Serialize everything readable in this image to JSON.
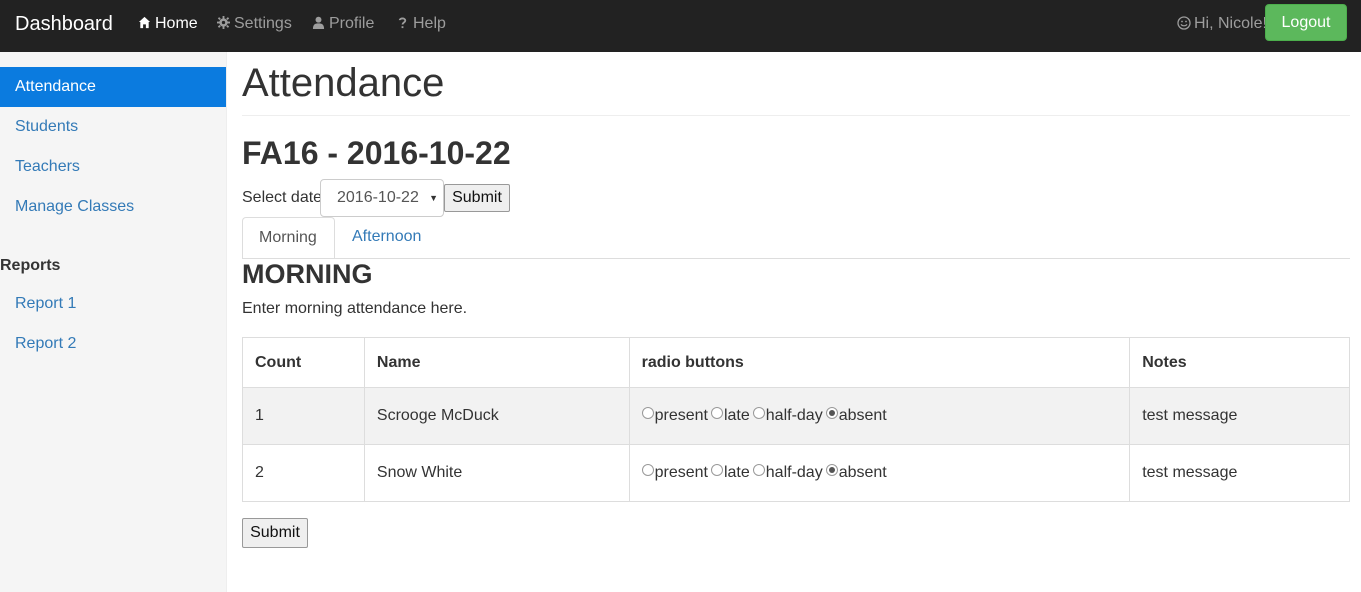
{
  "navbar": {
    "brand": "Dashboard",
    "links": [
      {
        "label": "Home",
        "icon": "home-icon",
        "active": true
      },
      {
        "label": "Settings",
        "icon": "gear-icon",
        "active": false
      },
      {
        "label": "Profile",
        "icon": "user-icon",
        "active": false
      },
      {
        "label": "Help",
        "icon": "question-icon",
        "active": false
      }
    ],
    "greeting": "Hi, Nicole!",
    "logout_label": "Logout",
    "colors": {
      "background": "#222222",
      "logout": "#5cb85c"
    }
  },
  "sidebar": {
    "items": [
      {
        "label": "Attendance",
        "active": true
      },
      {
        "label": "Students"
      },
      {
        "label": "Teachers"
      },
      {
        "label": "Manage Classes"
      }
    ],
    "reports_heading": "Reports",
    "report_items": [
      {
        "label": "Report 1"
      },
      {
        "label": "Report 2"
      }
    ],
    "active_color": "#0b7bdf"
  },
  "main": {
    "page_title": "Attendance",
    "term_title": "FA16 - 2016-10-22",
    "select_label": "Select date",
    "selected_date": "2016-10-22",
    "submit_label": "Submit",
    "tabs": [
      {
        "label": "Morning",
        "active": true
      },
      {
        "label": "Afternoon",
        "active": false
      }
    ],
    "section_title": "MORNING",
    "section_desc": "Enter morning attendance here.",
    "table": {
      "headers": [
        "Count",
        "Name",
        "radio buttons",
        "Notes"
      ],
      "radio_options": [
        "present",
        "late",
        "half-day",
        "absent"
      ],
      "rows": [
        {
          "count": "1",
          "name": "Scrooge McDuck",
          "selected": "absent",
          "notes": "test message"
        },
        {
          "count": "2",
          "name": "Snow White",
          "selected": "absent",
          "notes": "test message"
        }
      ]
    },
    "bottom_submit_label": "Submit"
  }
}
